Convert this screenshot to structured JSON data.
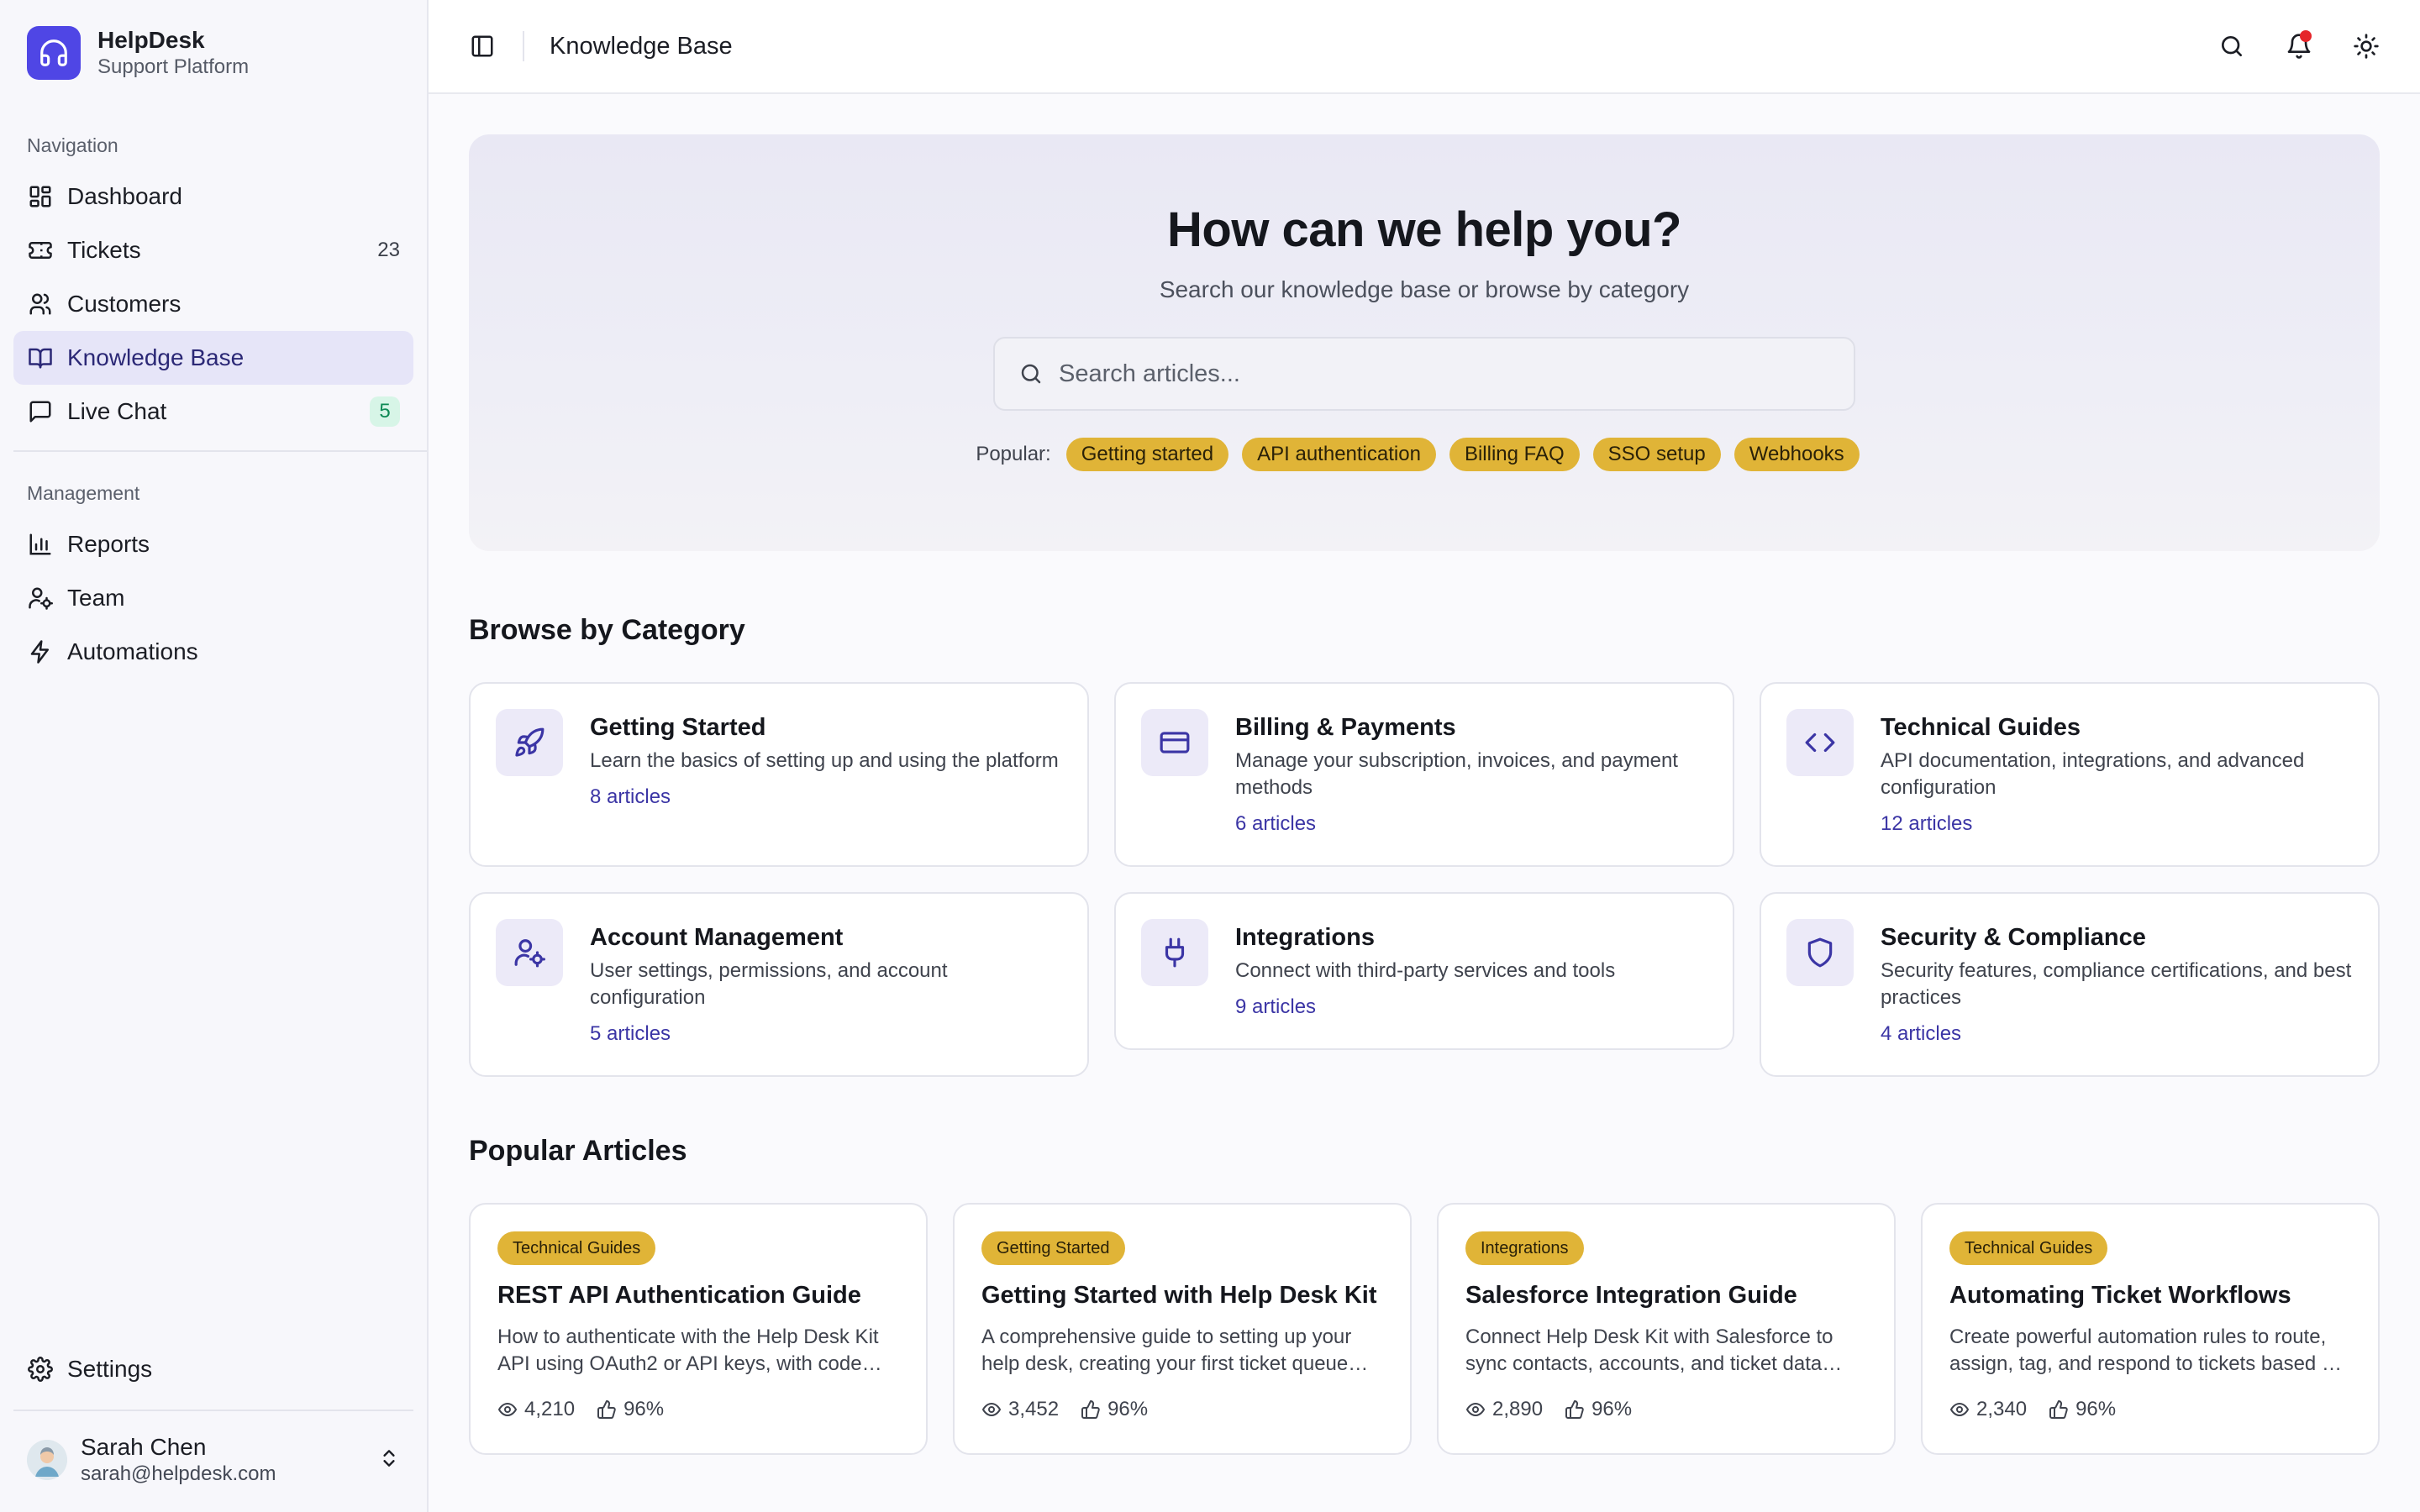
{
  "brand": {
    "name": "HelpDesk",
    "subtitle": "Support Platform"
  },
  "nav": {
    "section_label": "Navigation",
    "items": [
      {
        "label": "Dashboard",
        "icon": "dashboard-icon"
      },
      {
        "label": "Tickets",
        "icon": "ticket-icon",
        "count": "23"
      },
      {
        "label": "Customers",
        "icon": "users-icon"
      },
      {
        "label": "Knowledge Base",
        "icon": "book-icon",
        "active": true
      },
      {
        "label": "Live Chat",
        "icon": "chat-icon",
        "badge": "5"
      }
    ]
  },
  "management": {
    "section_label": "Management",
    "items": [
      {
        "label": "Reports",
        "icon": "bar-chart-icon"
      },
      {
        "label": "Team",
        "icon": "user-settings-icon"
      },
      {
        "label": "Automations",
        "icon": "lightning-icon"
      }
    ]
  },
  "settings": {
    "label": "Settings"
  },
  "user": {
    "name": "Sarah Chen",
    "email": "sarah@helpdesk.com"
  },
  "topbar": {
    "title": "Knowledge Base"
  },
  "hero": {
    "title": "How can we help you?",
    "subtitle": "Search our knowledge base or browse by category",
    "search_placeholder": "Search articles...",
    "popular_label": "Popular:",
    "chips": [
      "Getting started",
      "API authentication",
      "Billing FAQ",
      "SSO setup",
      "Webhooks"
    ]
  },
  "categories": {
    "title": "Browse by Category",
    "items": [
      {
        "title": "Getting Started",
        "desc": "Learn the basics of setting up and using the platform",
        "count": "8 articles",
        "icon": "rocket-icon"
      },
      {
        "title": "Billing & Payments",
        "desc": "Manage your subscription, invoices, and payment methods",
        "count": "6 articles",
        "icon": "credit-card-icon"
      },
      {
        "title": "Technical Guides",
        "desc": "API documentation, integrations, and advanced configuration",
        "count": "12 articles",
        "icon": "code-icon"
      },
      {
        "title": "Account Management",
        "desc": "User settings, permissions, and account configuration",
        "count": "5 articles",
        "icon": "user-cog-icon"
      },
      {
        "title": "Integrations",
        "desc": "Connect with third-party services and tools",
        "count": "9 articles",
        "icon": "plug-icon"
      },
      {
        "title": "Security & Compliance",
        "desc": "Security features, compliance certifications, and best practices",
        "count": "4 articles",
        "icon": "shield-icon"
      }
    ]
  },
  "popular_articles": {
    "title": "Popular Articles",
    "items": [
      {
        "tag": "Technical Guides",
        "title": "REST API Authentication Guide",
        "desc": "How to authenticate with the Help Desk Kit API using OAuth2 or API keys, with code examples",
        "views": "4,210",
        "helpful": "96%"
      },
      {
        "tag": "Getting Started",
        "title": "Getting Started with Help Desk Kit",
        "desc": "A comprehensive guide to setting up your help desk, creating your first ticket queue and inviting your team",
        "views": "3,452",
        "helpful": "96%"
      },
      {
        "tag": "Integrations",
        "title": "Salesforce Integration Guide",
        "desc": "Connect Help Desk Kit with Salesforce to sync contacts, accounts, and ticket data automatically",
        "views": "2,890",
        "helpful": "96%"
      },
      {
        "tag": "Technical Guides",
        "title": "Automating Ticket Workflows",
        "desc": "Create powerful automation rules to route, assign, tag, and respond to tickets based on conditions",
        "views": "2,340",
        "helpful": "96%"
      }
    ]
  },
  "colors": {
    "accent": "#4f46e5",
    "chip": "#e0b437",
    "active_nav_bg": "#e6e5f8",
    "notification": "#e5252a"
  }
}
